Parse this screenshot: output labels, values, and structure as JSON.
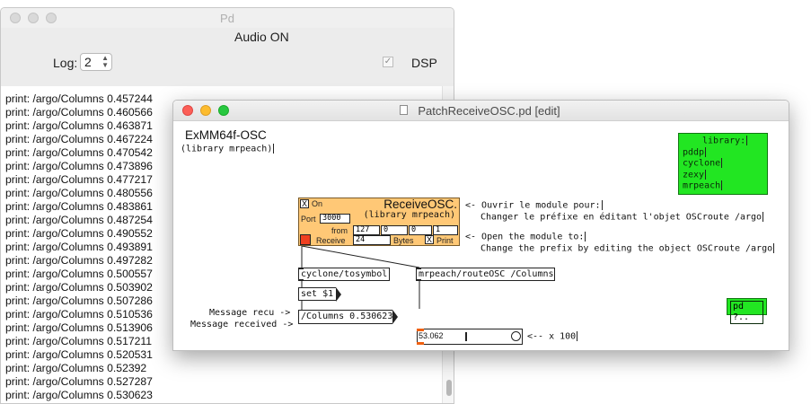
{
  "pd_window": {
    "title": "Pd",
    "audio_status": "Audio ON",
    "log_label": "Log:",
    "log_value": "2",
    "dsp_label": "DSP",
    "dsp_check": "✓",
    "console": [
      "print: /argo/Columns 0.457244",
      "print: /argo/Columns 0.460566",
      "print: /argo/Columns 0.463871",
      "print: /argo/Columns 0.467224",
      "print: /argo/Columns 0.470542",
      "print: /argo/Columns 0.473896",
      "print: /argo/Columns 0.477217",
      "print: /argo/Columns 0.480556",
      "print: /argo/Columns 0.483861",
      "print: /argo/Columns 0.487254",
      "print: /argo/Columns 0.490552",
      "print: /argo/Columns 0.493891",
      "print: /argo/Columns 0.497282",
      "print: /argo/Columns 0.500557",
      "print: /argo/Columns 0.503902",
      "print: /argo/Columns 0.507286",
      "print: /argo/Columns 0.510536",
      "print: /argo/Columns 0.513906",
      "print: /argo/Columns 0.517211",
      "print: /argo/Columns 0.520531",
      "print: /argo/Columns 0.52392",
      "print: /argo/Columns 0.527287",
      "print: /argo/Columns 0.530623"
    ]
  },
  "patch_window": {
    "title": "PatchReceiveOSC.pd [edit]",
    "heading": "ExMM64f-OSC",
    "subheading": "(library mrpeach)",
    "library_lines": [
      "library:",
      "pddp",
      "cyclone",
      "zexy",
      "mrpeach"
    ],
    "comment_fr_1": "<- Ouvrir le module pour:",
    "comment_fr_2": "Changer le préfixe en éditant l'objet OSCroute /argo",
    "comment_en_1": "<- Open the module to:",
    "comment_en_2": "Change the prefix by editing the object OSCroute /argo",
    "module": {
      "on_toggle": "X",
      "on_label": "On",
      "title": "ReceiveOSC.",
      "subtitle": "(library mrpeach)",
      "port_label": "Port",
      "port_value": "3000",
      "from_label": "from",
      "from_values": [
        "127",
        "0",
        "0",
        "1"
      ],
      "receive_label": "Receive",
      "bytes_value": "24",
      "bytes_label": "Bytes",
      "print_toggle": "X",
      "print_label": "Print"
    },
    "obj_tosymbol": "cyclone/tosymbol",
    "obj_routeosc": "mrpeach/routeOSC /Columns",
    "msg_set": "set $1",
    "message_recu": "Message recu ->",
    "message_received": "Message received ->",
    "msg_columns": "/Columns 0.530623",
    "slider_value": "53.062",
    "slider_position": 0.53,
    "times_100": "<-- x 100",
    "pd_help": "pd ?.."
  }
}
